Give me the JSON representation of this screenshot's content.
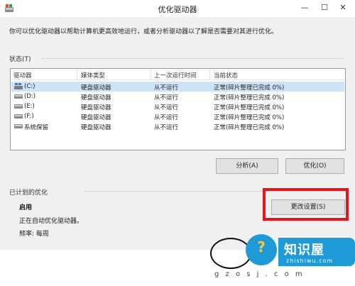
{
  "window": {
    "title": "优化驱动器",
    "minimize": "—",
    "maximize": "☐",
    "close": "✕"
  },
  "intro": "你可以优化驱动器以帮助计算机更高效地运行，或者分析驱动器以了解是否需要对其进行优化。",
  "status_section": {
    "label": "状态(T)"
  },
  "columns": [
    "驱动器",
    "媒体类型",
    "上一次运行时间",
    "当前状态"
  ],
  "drives": [
    {
      "name": "(C:)",
      "media": "硬盘驱动器",
      "last_run": "从不运行",
      "status": "正常(碎片整理已完成 0%)",
      "icon": "system-drive-icon"
    },
    {
      "name": "(D:)",
      "media": "硬盘驱动器",
      "last_run": "从不运行",
      "status": "正常(碎片整理已完成 0%)",
      "icon": "hard-drive-icon"
    },
    {
      "name": "(E:)",
      "media": "硬盘驱动器",
      "last_run": "从不运行",
      "status": "正常(碎片整理已完成 0%)",
      "icon": "hard-drive-icon"
    },
    {
      "name": "(F:)",
      "media": "硬盘驱动器",
      "last_run": "从不运行",
      "status": "正常(碎片整理已完成 0%)",
      "icon": "hard-drive-icon"
    },
    {
      "name": "系统保留",
      "media": "硬盘驱动器",
      "last_run": "从不运行",
      "status": "正常(碎片整理已完成 0%)",
      "icon": "hard-drive-icon"
    }
  ],
  "buttons": {
    "analyze": "分析(A)",
    "optimize": "优化(O)",
    "change_settings": "更改设置(S)"
  },
  "schedule": {
    "label": "已计划的优化",
    "status": "启用",
    "description": "正在自动优化驱动器。",
    "frequency": "频率: 每周"
  },
  "watermark": {
    "brand": "知识屋",
    "domain": "zhishiwu.com",
    "url": "g z o s j . c o m"
  },
  "colors": {
    "highlight": "#e8141b",
    "selected_row": "#cfe3f7",
    "brand_blue": "#1e9bd7"
  }
}
